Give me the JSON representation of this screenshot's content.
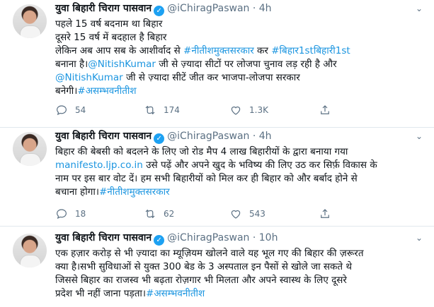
{
  "tweets": [
    {
      "name": "युवा बिहारी चिराग पासवान",
      "handle": "@iChiragPaswan",
      "time": "4h",
      "lines": [
        [
          {
            "t": "पहले 15 वर्ष बदनाम था बिहार"
          }
        ],
        [
          {
            "t": "दूसरे 15 वर्ष में बदहाल है बिहार"
          }
        ],
        [
          {
            "t": "लेकिन अब आप सब के आशीर्वाद से "
          },
          {
            "t": "#नीतीशमुक्तसरकार",
            "link": true
          },
          {
            "t": " कर "
          },
          {
            "t": "#बिहार1stबिहारी1st",
            "link": true
          }
        ],
        [
          {
            "t": "बनाना है।"
          },
          {
            "t": "@NitishKumar",
            "link": true
          },
          {
            "t": " जी से ज़्यादा सीटों पर लोजपा चुनाव लड़ रही है और"
          }
        ],
        [
          {
            "t": "@NitishKumar",
            "link": true
          },
          {
            "t": " जी से ज़्यादा सीटें जीत कर भाजपा-लोजपा सरकार"
          }
        ],
        [
          {
            "t": "बनेगी।"
          },
          {
            "t": "#असम्भवनीतीश",
            "link": true
          }
        ]
      ],
      "replies": "54",
      "retweets": "174",
      "likes": "1.3K"
    },
    {
      "name": "युवा बिहारी चिराग पासवान",
      "handle": "@iChiragPaswan",
      "time": "4h",
      "lines": [
        [
          {
            "t": "बिहार की बेबसी को बदलने के लिए जो रोड मैप 4 लाख बिहारीयों के द्वारा बनाया गया"
          }
        ],
        [
          {
            "t": "manifesto.ljp.co.in",
            "link": true
          },
          {
            "t": " उसे पढ़ें और अपने खुद के भविष्य की लिए उठ कर सिर्फ़ विकास के"
          }
        ],
        [
          {
            "t": "नाम पर इस बार वोट दें। हम सभी बिहारीयों को मिल कर ही बिहार को और बर्बाद होने से"
          }
        ],
        [
          {
            "t": "बचाना होगा।"
          },
          {
            "t": "#नीतीशमुक्तसरकार",
            "link": true
          }
        ]
      ],
      "replies": "18",
      "retweets": "62",
      "likes": "543"
    },
    {
      "name": "युवा बिहारी चिराग पासवान",
      "handle": "@iChiragPaswan",
      "time": "10h",
      "lines": [
        [
          {
            "t": "एक हज़ार करोड़ से भी ज़्यादा का म्यूज़ियम खोलने वाले यह भूल गए की बिहार की ज़रूरत"
          }
        ],
        [
          {
            "t": "क्या है।सभी सुविधाओं से युक्त 300 बेड के 3 अस्पताल इन पैसों से खोले जा सकते थे"
          }
        ],
        [
          {
            "t": "जिससे बिहार का राजस्व भी बढ़ता रोज़गार भी मिलता और अपने स्वास्थ के लिए दूसरे"
          }
        ],
        [
          {
            "t": "प्रदेश भी नहीं जाना पड़ता।"
          },
          {
            "t": "#असम्भवनीतीश",
            "link": true
          }
        ]
      ]
    }
  ],
  "colors": {
    "link": "#1b95e0",
    "muted": "#5b7083",
    "verified": "#1da1f2"
  },
  "icons": [
    "reply-icon",
    "retweet-icon",
    "like-icon",
    "share-icon",
    "verified-badge-icon",
    "more-chevron-icon"
  ]
}
